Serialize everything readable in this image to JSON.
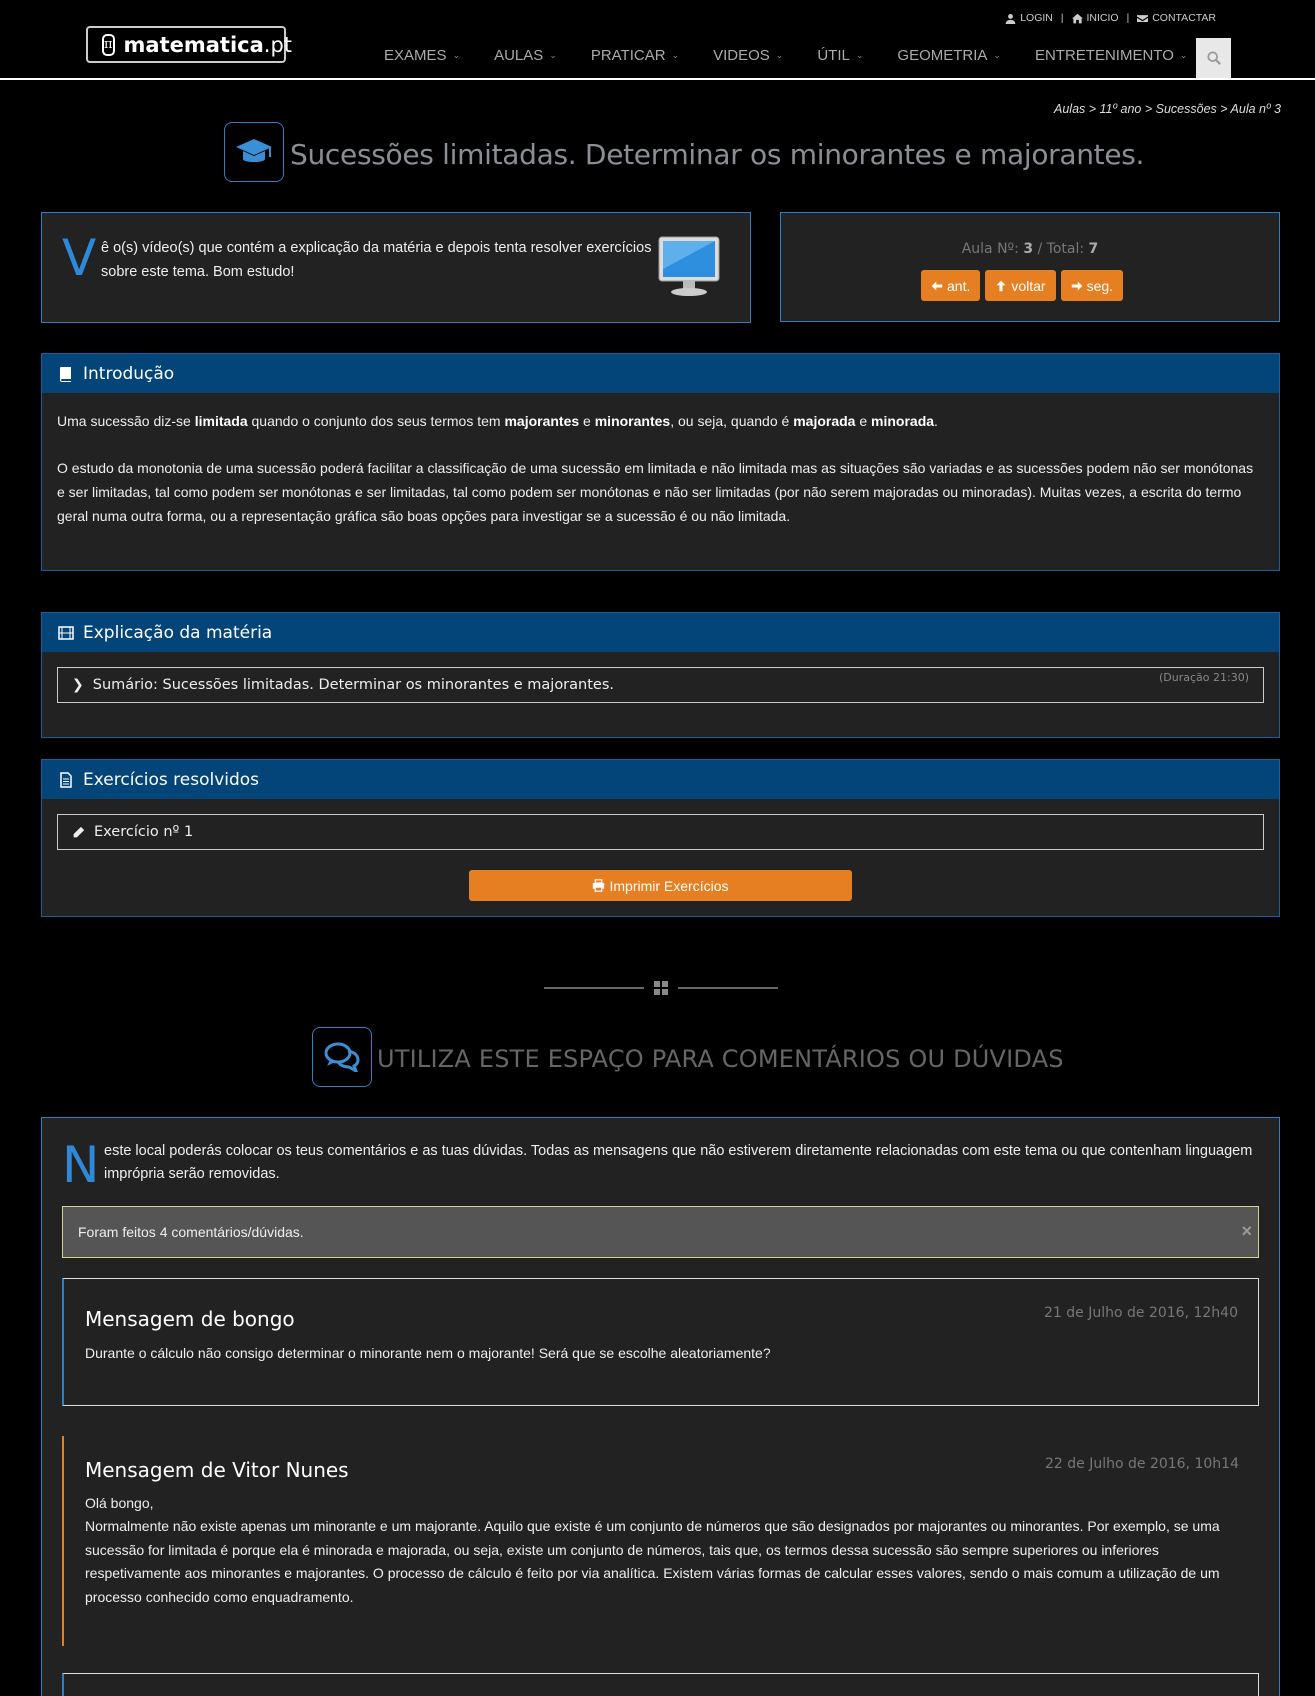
{
  "header": {
    "logo_text": "matematica",
    "logo_tld": ".pt",
    "logo_symbol": "π",
    "top_links": [
      {
        "label": "LOGIN",
        "icon": "user-icon"
      },
      {
        "label": "INICIO",
        "icon": "home-icon"
      },
      {
        "label": "CONTACTAR",
        "icon": "envelope-icon"
      }
    ],
    "separator": "|",
    "nav": [
      "EXAMES",
      "AULAS",
      "PRATICAR",
      "VIDEOS",
      "ÚTIL",
      "GEOMETRIA",
      "ENTRETENIMENTO"
    ],
    "search_icon": "search-icon"
  },
  "breadcrumb": "Aulas > 11º ano > Sucessões > Aula nº 3",
  "page_title": "Sucessões limitadas. Determinar os minorantes e majorantes.",
  "intro_card": {
    "dropcap": "V",
    "text": "ê o(s) vídeo(s) que contém a explicação da matéria e depois tenta resolver exercícios sobre este tema. Bom estudo!"
  },
  "aula_nav": {
    "label_num": "Aula Nº: ",
    "num": "3",
    "label_total": " / Total: ",
    "total": "7",
    "prev_label": "ant.",
    "back_label": "voltar",
    "next_label": "seg."
  },
  "introducao": {
    "title": "Introdução",
    "p1": {
      "t1": "Uma sucessão diz-se ",
      "b1": "limitada",
      "t2": " quando o conjunto dos seus termos tem ",
      "b2": "majorantes",
      "t3": " e ",
      "b3": "minorantes",
      "t4": ", ou seja, quando é ",
      "b4": "majorada",
      "t5": " e ",
      "b5": "minorada",
      "t6": "."
    },
    "p2": "O estudo da monotonia de uma sucessão poderá facilitar a classificação de uma sucessão em limitada e não limitada mas as situações são variadas e as sucessões podem não ser monótonas e ser limitadas, tal como podem ser monótonas e ser limitadas, tal como podem ser monótonas e não ser limitadas (por não serem majoradas ou minoradas). Muitas vezes, a escrita do termo geral numa outra forma, ou a representação gráfica são boas opções para investigar se a sucessão é ou não limitada."
  },
  "explicacao": {
    "title": "Explicação da matéria",
    "item_label": "Sumário: Sucessões limitadas. Determinar os minorantes e majorantes.",
    "duration": "(Duração 21:30)"
  },
  "exercicios": {
    "title": "Exercícios resolvidos",
    "item_label": "Exercício nº 1",
    "print_label": "Imprimir Exercícios"
  },
  "comments": {
    "title": "UTILIZA ESTE ESPAÇO PARA COMENTÁRIOS OU DÚVIDAS",
    "dropcap": "N",
    "intro": "este local poderás colocar os teus comentários e as tuas dúvidas. Todas as mensagens que não estiverem diretamente relacionadas com este tema ou que contenham linguagem imprópria serão removidas.",
    "alert": "Foram feitos 4 comentários/dúvidas.",
    "alert_close": "×",
    "messages": [
      {
        "title": "Mensagem de bongo",
        "date": "21 de Julho de 2016, 12h40",
        "text": "Durante o cálculo não consigo determinar o minorante nem o majorante! Será que se escolhe aleatoriamente?"
      },
      {
        "title": "Mensagem de Vitor Nunes",
        "date": "22 de Julho de 2016, 10h14",
        "greeting": "Olá bongo,",
        "text": "Normalmente não existe apenas um minorante e um majorante. Aquilo que existe é um conjunto de números que são designados por majorantes ou minorantes. Por exemplo, se uma sucessão for limitada é porque ela é minorada e majorada, ou seja, existe um conjunto de números, tais que, os termos dessa sucessão são sempre superiores ou inferiores respetivamente aos minorantes e majorantes. O processo de cálculo é feito por via analítica. Existem várias formas de calcular esses valores, sendo o mais comum a utilização de um processo conhecido como enquadramento."
      }
    ]
  },
  "colors": {
    "accent_blue": "#2e7fc2",
    "header_blue": "#034578",
    "orange": "#e67e22"
  }
}
